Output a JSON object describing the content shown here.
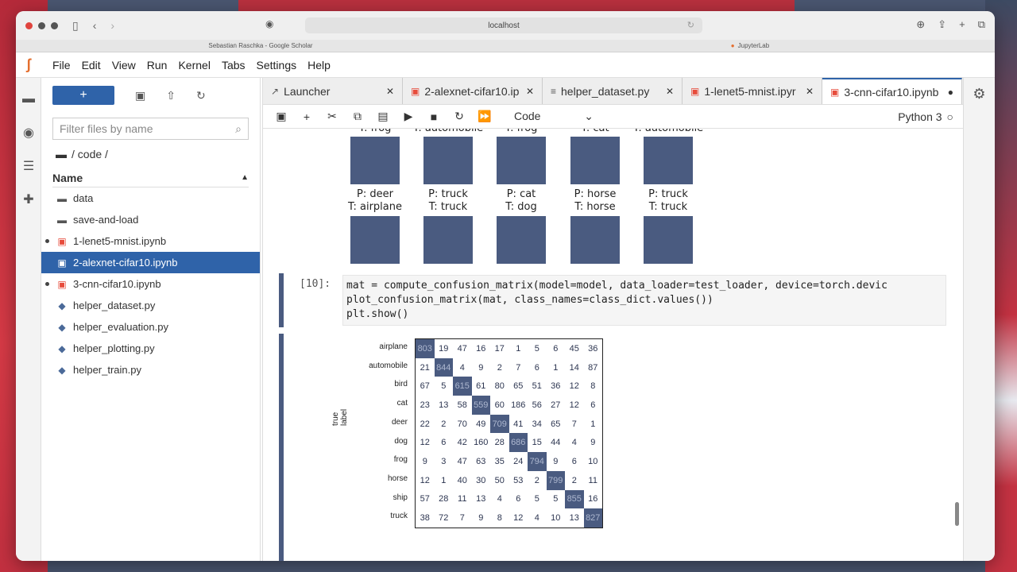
{
  "browser": {
    "address": "localhost",
    "tabs": [
      {
        "label": "Sebastian Raschka - Google Scholar"
      },
      {
        "label": "JupyterLab"
      }
    ]
  },
  "menu": [
    "File",
    "Edit",
    "View",
    "Run",
    "Kernel",
    "Tabs",
    "Settings",
    "Help"
  ],
  "filebrowser": {
    "new_label": "+",
    "filter_placeholder": "Filter files by name",
    "breadcrumb": "/ code /",
    "column_name": "Name",
    "files": [
      {
        "name": "data",
        "type": "folder",
        "running": false,
        "selected": false
      },
      {
        "name": "save-and-load",
        "type": "folder",
        "running": false,
        "selected": false
      },
      {
        "name": "1-lenet5-mnist.ipynb",
        "type": "notebook",
        "running": true,
        "selected": false
      },
      {
        "name": "2-alexnet-cifar10.ipynb",
        "type": "notebook",
        "running": false,
        "selected": true
      },
      {
        "name": "3-cnn-cifar10.ipynb",
        "type": "notebook",
        "running": true,
        "selected": false
      },
      {
        "name": "helper_dataset.py",
        "type": "python",
        "running": false,
        "selected": false
      },
      {
        "name": "helper_evaluation.py",
        "type": "python",
        "running": false,
        "selected": false
      },
      {
        "name": "helper_plotting.py",
        "type": "python",
        "running": false,
        "selected": false
      },
      {
        "name": "helper_train.py",
        "type": "python",
        "running": false,
        "selected": false
      }
    ]
  },
  "doc_tabs": [
    {
      "label": "Launcher",
      "icon": "launcher-icon",
      "active": false
    },
    {
      "label": "2-alexnet-cifar10.ip",
      "icon": "notebook-icon",
      "active": false
    },
    {
      "label": "helper_dataset.py",
      "icon": "file-icon",
      "active": false
    },
    {
      "label": "1-lenet5-mnist.ipyr",
      "icon": "notebook-icon",
      "active": false
    },
    {
      "label": "3-cnn-cifar10.ipynb",
      "icon": "notebook-icon",
      "active": true
    }
  ],
  "notebook_toolbar": {
    "cell_type": "Code",
    "kernel": "Python 3"
  },
  "top_row_labels": [
    {
      "t": "T: frog"
    },
    {
      "t": "T: automobile"
    },
    {
      "t": "T: frog"
    },
    {
      "t": "T: cat"
    },
    {
      "t": "T: automobile"
    }
  ],
  "second_row_labels": [
    {
      "p": "P: deer",
      "t": "T: airplane"
    },
    {
      "p": "P: truck",
      "t": "T: truck"
    },
    {
      "p": "P: cat",
      "t": "T: dog"
    },
    {
      "p": "P: horse",
      "t": "T: horse"
    },
    {
      "p": "P: truck",
      "t": "T: truck"
    }
  ],
  "cell": {
    "prompt": "[10]:",
    "code": "mat = compute_confusion_matrix(model=model, data_loader=test_loader, device=torch.devic\nplot_confusion_matrix(mat, class_names=class_dict.values())\nplt.show()"
  },
  "chart_data": {
    "type": "heatmap",
    "ylabel": "true label",
    "rows": [
      "airplane",
      "automobile",
      "bird",
      "cat",
      "deer",
      "dog",
      "frog",
      "horse",
      "ship",
      "truck"
    ],
    "values": [
      [
        803,
        19,
        47,
        16,
        17,
        1,
        5,
        6,
        45,
        36
      ],
      [
        21,
        844,
        4,
        9,
        2,
        7,
        6,
        1,
        14,
        87
      ],
      [
        67,
        5,
        615,
        61,
        80,
        65,
        51,
        36,
        12,
        8
      ],
      [
        23,
        13,
        58,
        559,
        60,
        186,
        56,
        27,
        12,
        6
      ],
      [
        22,
        2,
        70,
        49,
        709,
        41,
        34,
        65,
        7,
        1
      ],
      [
        12,
        6,
        42,
        160,
        28,
        686,
        15,
        44,
        4,
        9
      ],
      [
        9,
        3,
        47,
        63,
        35,
        24,
        794,
        9,
        6,
        10
      ],
      [
        12,
        1,
        40,
        30,
        50,
        53,
        2,
        799,
        2,
        11
      ],
      [
        57,
        28,
        11,
        13,
        4,
        6,
        5,
        5,
        855,
        16
      ],
      [
        38,
        72,
        7,
        9,
        8,
        12,
        4,
        10,
        13,
        827
      ]
    ]
  }
}
